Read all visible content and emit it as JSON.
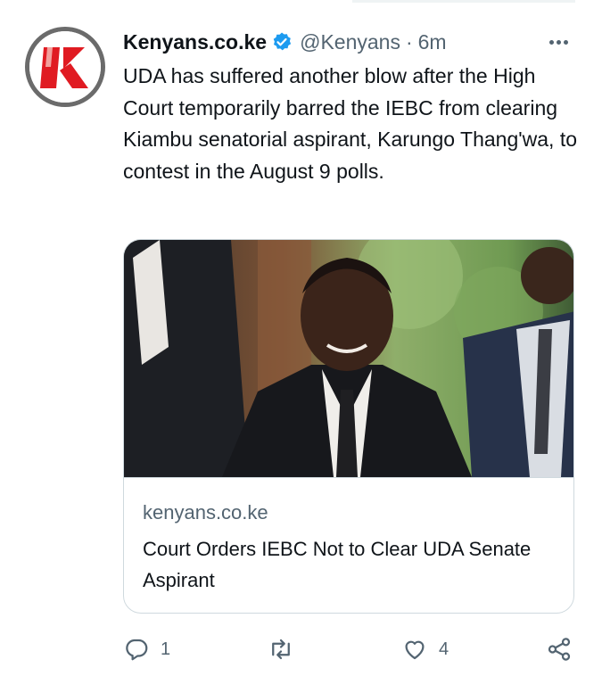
{
  "tweet": {
    "display_name": "Kenyans.co.ke",
    "handle": "@Kenyans",
    "separator": "·",
    "time": "6m",
    "text": "UDA has suffered another blow after the High Court temporarily barred the IEBC from clearing Kiambu senatorial aspirant, Karungo Thang'wa, to contest in the August 9 polls.",
    "avatar_letter": "K"
  },
  "card": {
    "domain": "kenyans.co.ke",
    "title": "Court Orders IEBC Not to Clear UDA Senate Aspirant"
  },
  "actions": {
    "reply_count": "1",
    "retweet_count": "",
    "like_count": "4"
  },
  "colors": {
    "text": "#0f1419",
    "secondary": "#536471",
    "verified": "#1d9bf0",
    "brand_red": "#e01b22",
    "border": "#cfd9de"
  },
  "icons": [
    "verified-icon",
    "more-icon",
    "reply-icon",
    "retweet-icon",
    "like-icon",
    "share-icon"
  ]
}
